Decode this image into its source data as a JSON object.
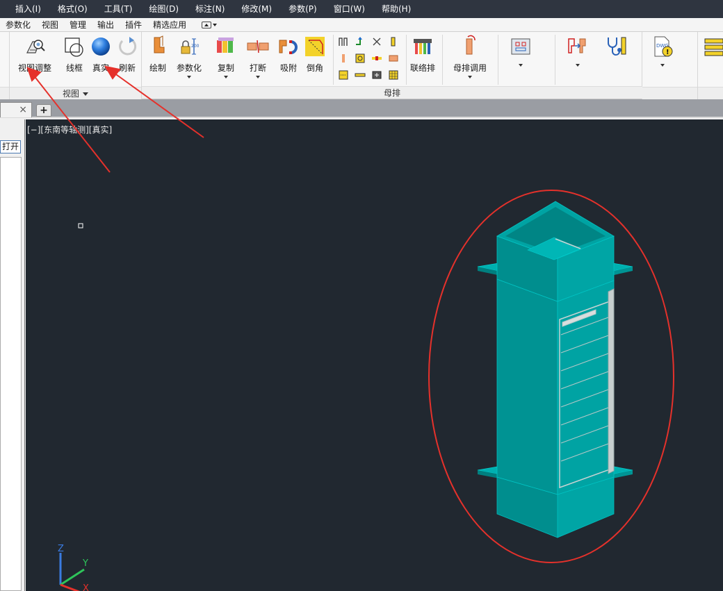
{
  "menu": [
    "插入(I)",
    "格式(O)",
    "工具(T)",
    "绘图(D)",
    "标注(N)",
    "修改(M)",
    "参数(P)",
    "窗口(W)",
    "帮助(H)"
  ],
  "ribbon_tabs": [
    "参数化",
    "视图",
    "管理",
    "输出",
    "插件",
    "精选应用"
  ],
  "panels": {
    "view": {
      "title": "视图",
      "tools": [
        "视图调整",
        "线框",
        "真实",
        "刷新"
      ]
    },
    "busbar": {
      "title": "母排",
      "tools": [
        "绘制",
        "参数化",
        "复制",
        "打断",
        "吸附",
        "倒角",
        "联络排",
        "母排调用"
      ]
    },
    "more_tools": [
      "钣金开孔",
      "2D识别",
      "母排检查",
      "加工图纸",
      "母排套"
    ]
  },
  "left_panel": {
    "open_button": "打开"
  },
  "viewport": {
    "label": "[−][东南等轴测][真实]"
  },
  "ucs": {
    "x": "X",
    "y": "Y",
    "z": "Z"
  },
  "colors": {
    "teal": "#009a9a",
    "teal_light": "#00b3b3",
    "viewport_bg": "#212830",
    "annotation": "#e5312b"
  }
}
